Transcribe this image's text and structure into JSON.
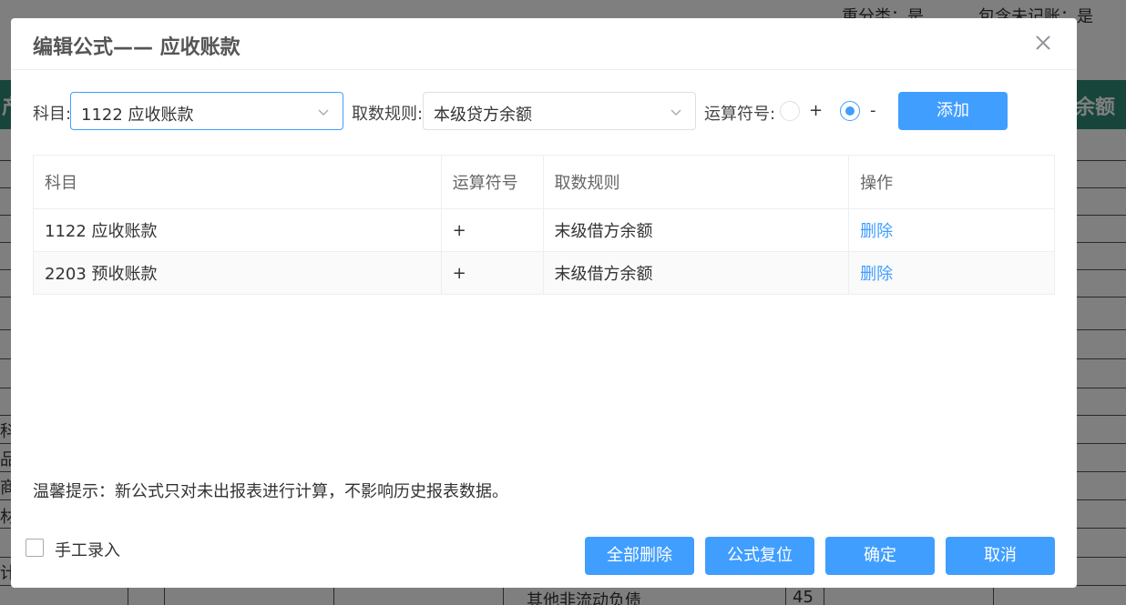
{
  "background": {
    "reclassify": "重分类：是",
    "include_unposted": "包含未记账：是",
    "band_left": "产",
    "band_right": "余额",
    "left_cells": [
      "科",
      "品",
      "商品",
      "材料",
      "计"
    ],
    "bottom_text": "其他非流动负债",
    "bottom_num": "45"
  },
  "dialog": {
    "title": "编辑公式—— 应收账款",
    "close_icon": "close-icon"
  },
  "form": {
    "subject_label": "科目:",
    "subject_value": "1122 应收账款",
    "rule_label": "取数规则:",
    "rule_value": "本级贷方余额",
    "operator_label": "运算符号:",
    "plus_label": "+",
    "minus_label": "-",
    "selected_operator": "-",
    "add_button": "添加"
  },
  "table": {
    "columns": [
      "科目",
      "运算符号",
      "取数规则",
      "操作"
    ],
    "rows": [
      {
        "subject": "1122 应收账款",
        "operator": "+",
        "rule": "末级借方余额",
        "action": "删除"
      },
      {
        "subject": "2203 预收账款",
        "operator": "+",
        "rule": "末级借方余额",
        "action": "删除"
      }
    ]
  },
  "tip": "温馨提示：新公式只对未出报表进行计算，不影响历史报表数据。",
  "manual_entry_label": "手工录入",
  "footer": {
    "delete_all": "全部删除",
    "reset_formula": "公式复位",
    "confirm": "确定",
    "cancel": "取消"
  },
  "colors": {
    "primary": "#409eff",
    "band": "#2e8b76"
  }
}
